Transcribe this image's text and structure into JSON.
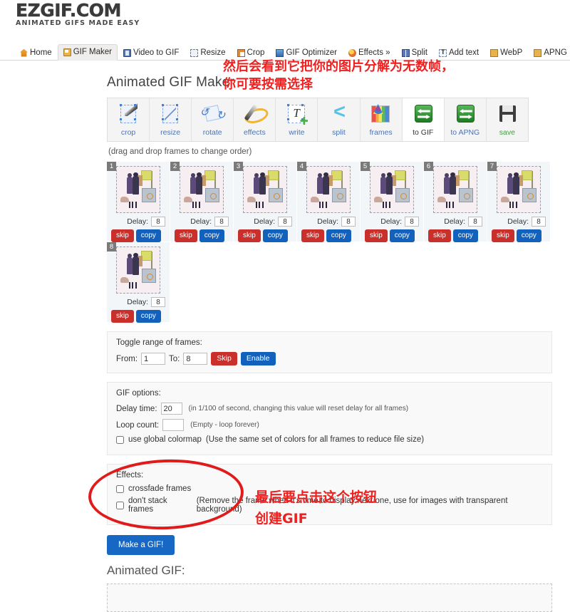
{
  "site": {
    "logo_text": "EZGIF.COM",
    "logo_tagline": "ANIMATED GIFS MADE EASY"
  },
  "nav": {
    "items": [
      {
        "label": "Home",
        "icon": "home-icon",
        "active": false
      },
      {
        "label": "GIF Maker",
        "icon": "gif-maker-icon",
        "active": true
      },
      {
        "label": "Video to GIF",
        "icon": "video-icon",
        "active": false
      },
      {
        "label": "Resize",
        "icon": "resize-icon",
        "active": false
      },
      {
        "label": "Crop",
        "icon": "crop-icon",
        "active": false
      },
      {
        "label": "GIF Optimizer",
        "icon": "optimizer-icon",
        "active": false
      },
      {
        "label": "Effects »",
        "icon": "effects-icon",
        "active": false
      },
      {
        "label": "Split",
        "icon": "split-icon",
        "active": false
      },
      {
        "label": "Add text",
        "icon": "add-text-icon",
        "active": false
      },
      {
        "label": "WebP",
        "icon": "webp-icon",
        "active": false
      },
      {
        "label": "APNG",
        "icon": "apng-icon",
        "active": false
      }
    ]
  },
  "page": {
    "title": "Animated GIF Maker",
    "drag_hint": "(drag and drop frames to change order)",
    "result_title": "Animated GIF:"
  },
  "toolbar": {
    "tools": [
      {
        "label": "crop",
        "icon": "crop-tool-icon",
        "active": false
      },
      {
        "label": "resize",
        "icon": "resize-tool-icon",
        "active": false
      },
      {
        "label": "rotate",
        "icon": "rotate-tool-icon",
        "active": false
      },
      {
        "label": "effects",
        "icon": "effects-tool-icon",
        "active": false
      },
      {
        "label": "write",
        "icon": "write-tool-icon",
        "active": false
      },
      {
        "label": "split",
        "icon": "split-tool-icon",
        "active": false
      },
      {
        "label": "frames",
        "icon": "frames-tool-icon",
        "active": false
      },
      {
        "label": "to GIF",
        "icon": "to-gif-tool-icon",
        "active": true
      },
      {
        "label": "to APNG",
        "icon": "to-apng-tool-icon",
        "active": false
      },
      {
        "label": "save",
        "icon": "save-tool-icon",
        "active": false
      }
    ]
  },
  "frames": {
    "delay_label": "Delay:",
    "skip_label": "skip",
    "copy_label": "copy",
    "items": [
      {
        "number": "1",
        "delay": "8"
      },
      {
        "number": "2",
        "delay": "8"
      },
      {
        "number": "3",
        "delay": "8"
      },
      {
        "number": "4",
        "delay": "8"
      },
      {
        "number": "5",
        "delay": "8"
      },
      {
        "number": "6",
        "delay": "8"
      },
      {
        "number": "7",
        "delay": "8"
      },
      {
        "number": "8",
        "delay": "8"
      }
    ]
  },
  "toggle_range": {
    "title": "Toggle range of frames:",
    "from_label": "From:",
    "from_value": "1",
    "to_label": "To:",
    "to_value": "8",
    "skip_button": "Skip",
    "enable_button": "Enable"
  },
  "gif_options": {
    "title": "GIF options:",
    "delay_label": "Delay time:",
    "delay_value": "20",
    "delay_note": "(in 1/100 of second, changing this value will reset delay for all frames)",
    "loop_label": "Loop count:",
    "loop_value": "",
    "loop_note": "(Empty - loop forever)",
    "colormap_label": "use global colormap",
    "colormap_note": "(Use the same set of colors for all frames to reduce file size)"
  },
  "effects": {
    "title": "Effects:",
    "crossfade_label": "crossfade frames",
    "dont_stack_label": "don't stack frames",
    "dont_stack_note": "(Remove the frame when it's time to display next one, use for images with transparent background)"
  },
  "actions": {
    "make_gif": "Make a GIF!"
  },
  "annotations": {
    "top": "然后会看到它把你的图片分解为无数帧，\n你可要按需选择",
    "bottom": "最后要点击这个按钮\n创建GIF",
    "color": "#ef2020"
  }
}
